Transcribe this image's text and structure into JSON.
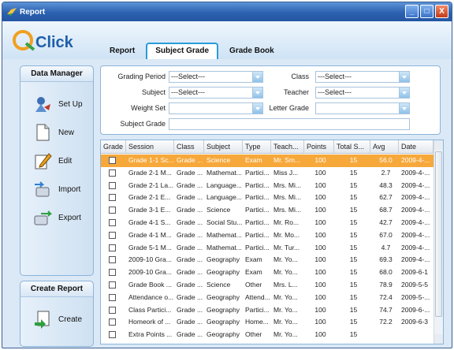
{
  "window": {
    "title": "Report",
    "controls": [
      "_",
      "□",
      "X"
    ]
  },
  "logo": {
    "text": "Click"
  },
  "tabs": [
    {
      "label": "Report"
    },
    {
      "label": "Subject Grade",
      "active": true
    },
    {
      "label": "Grade Book"
    }
  ],
  "data_manager": {
    "title": "Data Manager",
    "items": [
      {
        "label": "Set Up",
        "icon": "setup-icon"
      },
      {
        "label": "New",
        "icon": "new-document-icon"
      },
      {
        "label": "Edit",
        "icon": "edit-icon"
      },
      {
        "label": "Import",
        "icon": "import-icon"
      },
      {
        "label": "Export",
        "icon": "export-icon"
      }
    ]
  },
  "create_report": {
    "title": "Create Report",
    "create_label": "Create"
  },
  "filters": {
    "grading_period": {
      "label": "Grading Period",
      "value": "---Select---"
    },
    "class": {
      "label": "Class",
      "value": "---Select---"
    },
    "subject": {
      "label": "Subject",
      "value": "---Select---"
    },
    "teacher": {
      "label": "Teacher",
      "value": "---Select---"
    },
    "weight_set": {
      "label": "Weight Set",
      "value": ""
    },
    "letter_grade": {
      "label": "Letter Grade",
      "value": ""
    },
    "subject_grade": {
      "label": "Subject Grade",
      "value": ""
    }
  },
  "table": {
    "columns": [
      "Grade",
      "Session",
      "Class",
      "Subject",
      "Type",
      "Teach...",
      "Points",
      "Total S...",
      "Avg",
      "Date"
    ],
    "rows": [
      [
        "",
        "Grade 1-1 Sc...",
        "Grade ...",
        "Science",
        "Exam",
        "Mr. Sm...",
        "100",
        "15",
        "56.0",
        "2009-4-..."
      ],
      [
        "",
        "Grade 2-1 M...",
        "Grade ...",
        "Mathemat...",
        "Partici...",
        "Miss J...",
        "100",
        "15",
        "2.7",
        "2009-4-..."
      ],
      [
        "",
        "Grade 2-1 La...",
        "Grade ...",
        "Language...",
        "Partici...",
        "Mrs. Mi...",
        "100",
        "15",
        "48.3",
        "2009-4-..."
      ],
      [
        "",
        "Grade 2-1 E...",
        "Grade ...",
        "Language...",
        "Partici...",
        "Mrs. Mi...",
        "100",
        "15",
        "62.7",
        "2009-4-..."
      ],
      [
        "",
        "Grade 3-1 E...",
        "Grade ...",
        "Science",
        "Partici...",
        "Mrs. Mi...",
        "100",
        "15",
        "68.7",
        "2009-4-..."
      ],
      [
        "",
        "Grade 4-1 S...",
        "Grade ...",
        "Social Stu...",
        "Partici...",
        "Mr. Ro...",
        "100",
        "15",
        "42.7",
        "2009-4-..."
      ],
      [
        "",
        "Grade 4-1 M...",
        "Grade ...",
        "Mathemat...",
        "Partici...",
        "Mr. Mo...",
        "100",
        "15",
        "67.0",
        "2009-4-..."
      ],
      [
        "",
        "Grade 5-1 M...",
        "Grade ...",
        "Mathemat...",
        "Partici...",
        "Mr. Tur...",
        "100",
        "15",
        "4.7",
        "2009-4-..."
      ],
      [
        "",
        "2009-10 Gra...",
        "Grade ...",
        "Geography",
        "Exam",
        "Mr. Yo...",
        "100",
        "15",
        "69.3",
        "2009-4-..."
      ],
      [
        "",
        "2009-10 Gra...",
        "Grade ...",
        "Geography",
        "Exam",
        "Mr. Yo...",
        "100",
        "15",
        "68.0",
        "2009-6-1"
      ],
      [
        "",
        "Grade Book ...",
        "Grade ...",
        "Science",
        "Other",
        "Mrs. L...",
        "100",
        "15",
        "78.9",
        "2009-5-5"
      ],
      [
        "",
        "Attendance o...",
        "Grade ...",
        "Geography",
        "Attend...",
        "Mr. Yo...",
        "100",
        "15",
        "72.4",
        "2009-5-..."
      ],
      [
        "",
        "Class Partici...",
        "Grade ...",
        "Geography",
        "Partici...",
        "Mr. Yo...",
        "100",
        "15",
        "74.7",
        "2009-6-..."
      ],
      [
        "",
        "Homeork of ...",
        "Grade ...",
        "Geography",
        "Home...",
        "Mr. Yo...",
        "100",
        "15",
        "72.2",
        "2009-6-3"
      ],
      [
        "",
        "Extra Points ...",
        "Grade ...",
        "Geography",
        "Other",
        "Mr. Yo...",
        "100",
        "15",
        "",
        ""
      ]
    ],
    "selected_row": 0
  },
  "colors": {
    "accent": "#2a9bd8",
    "selection": "#f7a83a",
    "titlebar": "#2b61b0"
  }
}
